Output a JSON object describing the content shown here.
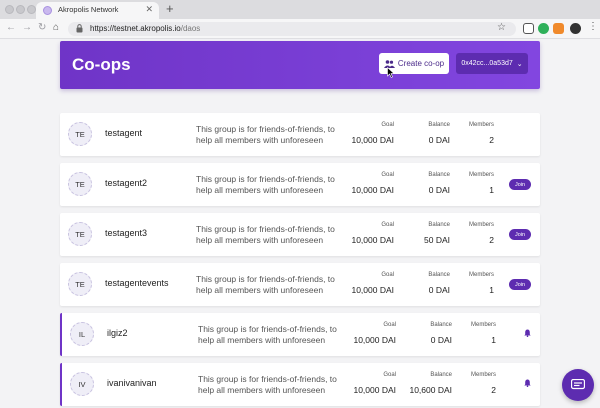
{
  "browser": {
    "tab_title": "Akropolis Network",
    "url_host": "https://testnet.akropolis.io",
    "url_path": "/daos"
  },
  "header": {
    "title": "Co-ops",
    "create_button": "Create co-op",
    "wallet_address": "0x42cc...0a53d7"
  },
  "labels": {
    "goal": "Goal",
    "balance": "Balance",
    "members": "Members",
    "join": "Join"
  },
  "coops": [
    {
      "initials": "TE",
      "name": "testagent",
      "description": "This group is for friends-of-friends, to help all members with unforeseen",
      "goal": "10,000 DAI",
      "balance": "0 DAI",
      "members": "2",
      "action": "none"
    },
    {
      "initials": "TE",
      "name": "testagent2",
      "description": "This group is for friends-of-friends, to help all members with unforeseen",
      "goal": "10,000 DAI",
      "balance": "0 DAI",
      "members": "1",
      "action": "join"
    },
    {
      "initials": "TE",
      "name": "testagent3",
      "description": "This group is for friends-of-friends, to help all members with unforeseen",
      "goal": "10,000 DAI",
      "balance": "50 DAI",
      "members": "2",
      "action": "join"
    },
    {
      "initials": "TE",
      "name": "testagentevents",
      "description": "This group is for friends-of-friends, to help all members with unforeseen",
      "goal": "10,000 DAI",
      "balance": "0 DAI",
      "members": "1",
      "action": "join"
    },
    {
      "initials": "IL",
      "name": "ilgiz2",
      "description": "This group is for friends-of-friends, to help all members with unforeseen",
      "goal": "10,000 DAI",
      "balance": "0 DAI",
      "members": "1",
      "action": "bell"
    },
    {
      "initials": "IV",
      "name": "ivanivanivan",
      "description": "This group is for friends-of-friends, to help all members with unforeseen",
      "goal": "10,000 DAI",
      "balance": "10,600 DAI",
      "members": "2",
      "action": "bell"
    }
  ],
  "colors": {
    "brand": "#6f34c7",
    "button": "#5d2cb0"
  },
  "icons": [
    "people-icon",
    "chevron-down-icon",
    "bell-icon",
    "chat-icon",
    "lock-icon",
    "star-icon"
  ]
}
